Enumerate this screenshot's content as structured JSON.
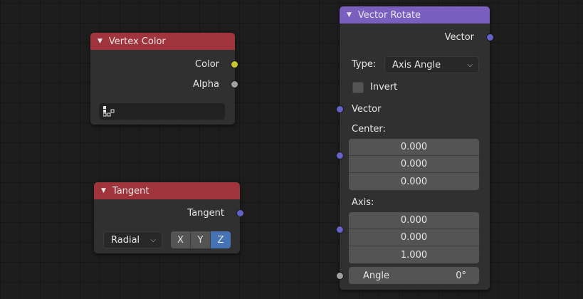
{
  "nodes": {
    "vertex_color": {
      "title": "Vertex Color",
      "outputs": [
        "Color",
        "Alpha"
      ],
      "layer_value": ""
    },
    "tangent": {
      "title": "Tangent",
      "output": "Tangent",
      "direction_type": "Radial",
      "axis_options": [
        "X",
        "Y",
        "Z"
      ],
      "axis_selected": "Z"
    },
    "vector_rotate": {
      "title": "Vector Rotate",
      "output": "Vector",
      "type_label": "Type:",
      "type_value": "Axis Angle",
      "invert_label": "Invert",
      "vector_label": "Vector",
      "center_label": "Center:",
      "center": [
        "0.000",
        "0.000",
        "0.000"
      ],
      "axis_label": "Axis:",
      "axis": [
        "0.000",
        "0.000",
        "1.000"
      ],
      "angle_label": "Angle",
      "angle_value": "0°"
    }
  },
  "colors": {
    "header_red": "#a0343c",
    "header_purple": "#7a5fbf",
    "socket_color": "#c7c729",
    "socket_float": "#a1a1a1",
    "socket_vector": "#6363c7",
    "active_button": "#4772b3"
  }
}
